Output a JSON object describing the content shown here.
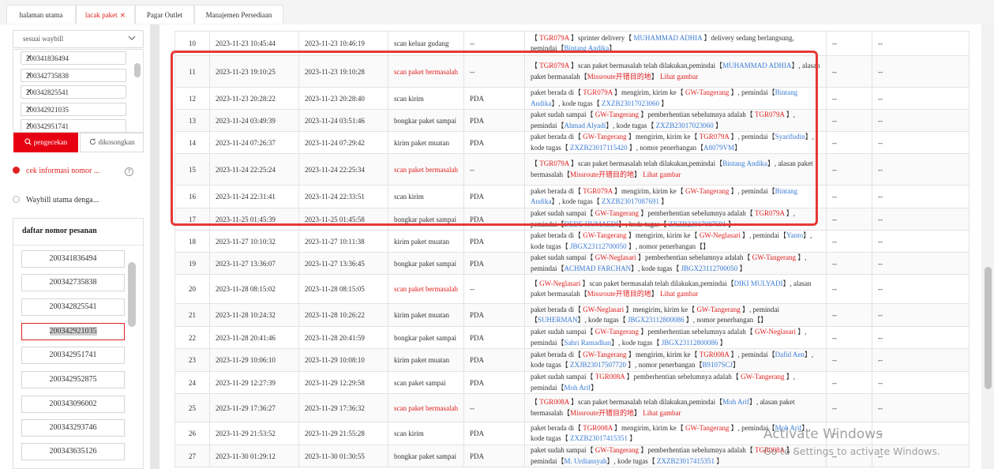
{
  "tabs": [
    {
      "label": "halaman utama",
      "closable": false,
      "active": false
    },
    {
      "label": "lacak paket",
      "closable": true,
      "active": true
    },
    {
      "label": "Pagar Outlet",
      "closable": false,
      "active": false
    },
    {
      "label": "Manajemen Persediaan",
      "closable": false,
      "active": false
    }
  ],
  "sidebar": {
    "waybill_select": "sesuai waybill",
    "waybill_chips": [
      "200341836494",
      "200342735838",
      "200342825541",
      "200342921035",
      "200342951741"
    ],
    "search_button": "pengecekan",
    "clear_button": "dikosongkan",
    "option_check": "cek informasi nomor ...",
    "option_master": "Waybill utama denga...",
    "order_list_title": "daftar nomor pesanan",
    "orders": [
      "200341836494",
      "200342735838",
      "200342825541",
      "200342921035",
      "200342951741",
      "200342952875",
      "200343096002",
      "200343293746",
      "200343635126"
    ],
    "selected_order_index": 3
  },
  "table": {
    "rows": [
      {
        "no": "10",
        "t1": "2023-11-23 10:45:44",
        "t2": "2023-11-23 10:46:19",
        "type": "scan keluar gudang",
        "type_red": false,
        "op": "--",
        "desc": [
          {
            "t": "【 "
          },
          {
            "t": "TGR079A",
            "c": "r"
          },
          {
            "t": " 】sprinter delivery【 "
          },
          {
            "t": "MUHAMMAD ADHIA",
            "c": "b"
          },
          {
            "t": " 】delivery sedang berlangsung, pemindai【"
          },
          {
            "t": "Bintang Andika",
            "c": "b"
          },
          {
            "t": "】"
          }
        ],
        "e1": "--",
        "e2": "--"
      },
      {
        "no": "11",
        "t1": "2023-11-23 19:10:25",
        "t2": "2023-11-23 19:10:28",
        "type": "scan paket bermasalah",
        "type_red": true,
        "op": "--",
        "desc": [
          {
            "t": "【 "
          },
          {
            "t": "TGR079A",
            "c": "r"
          },
          {
            "t": " 】scan paket bermasalah telah dilakukan,pemindai【"
          },
          {
            "t": "MUHAMMAD ADHIA",
            "c": "b"
          },
          {
            "t": "】, alasan paket bermasalah【"
          },
          {
            "t": "Missroute开错目的地",
            "c": "r"
          },
          {
            "t": "】 "
          },
          {
            "t": "Lihat gambar",
            "c": "r"
          }
        ],
        "e1": "--",
        "e2": "--"
      },
      {
        "no": "12",
        "t1": "2023-11-23 20:28:22",
        "t2": "2023-11-23 20:28:40",
        "type": "scan kirim",
        "type_red": false,
        "op": "PDA",
        "desc": [
          {
            "t": "paket berada di【 "
          },
          {
            "t": "TGR079A",
            "c": "r"
          },
          {
            "t": " 】mengirim, kirim ke【 "
          },
          {
            "t": "GW-Tangerang",
            "c": "r"
          },
          {
            "t": " 】, pemindai【"
          },
          {
            "t": "Bintang Andika",
            "c": "b"
          },
          {
            "t": "】, kode tugas【 "
          },
          {
            "t": "ZXZB23017023060",
            "c": "b"
          },
          {
            "t": " 】"
          }
        ],
        "e1": "--",
        "e2": "--"
      },
      {
        "no": "13",
        "t1": "2023-11-24 03:49:39",
        "t2": "2023-11-24 03:51:46",
        "type": "bongkar paket sampai",
        "type_red": false,
        "op": "PDA",
        "desc": [
          {
            "t": "paket sudah sampai【 "
          },
          {
            "t": "GW-Tangerang",
            "c": "r"
          },
          {
            "t": " 】pemberhentian sebelumnya adalah【 "
          },
          {
            "t": "TGR079A",
            "c": "r"
          },
          {
            "t": " 】, pemindai【"
          },
          {
            "t": "Ahmad Alyadi",
            "c": "b"
          },
          {
            "t": "】, kode tugas【 "
          },
          {
            "t": "ZXZB23017023060",
            "c": "b"
          },
          {
            "t": " 】"
          }
        ],
        "e1": "--",
        "e2": "--"
      },
      {
        "no": "14",
        "t1": "2023-11-24 07:26:37",
        "t2": "2023-11-24 07:29:42",
        "type": "kirim paket muatan",
        "type_red": false,
        "op": "PDA",
        "desc": [
          {
            "t": "paket berada di【 "
          },
          {
            "t": "GW-Tangerang",
            "c": "r"
          },
          {
            "t": " 】mengirim, kirim ke【 "
          },
          {
            "t": "TGR079A",
            "c": "r"
          },
          {
            "t": " 】, pemindai【"
          },
          {
            "t": "Syarifudin",
            "c": "b"
          },
          {
            "t": "】, kode tugas【 "
          },
          {
            "t": "ZXZB23017115420",
            "c": "b"
          },
          {
            "t": " 】, nomor penerbangan【"
          },
          {
            "t": "A8079VM",
            "c": "b"
          },
          {
            "t": "】"
          }
        ],
        "e1": "--",
        "e2": "--"
      },
      {
        "no": "15",
        "t1": "2023-11-24 22:25:24",
        "t2": "2023-11-24 22:25:34",
        "type": "scan paket bermasalah",
        "type_red": true,
        "op": "--",
        "desc": [
          {
            "t": "【 "
          },
          {
            "t": "TGR079A",
            "c": "r"
          },
          {
            "t": " 】scan paket bermasalah telah dilakukan,pemindai【"
          },
          {
            "t": "Bintang Andika",
            "c": "b"
          },
          {
            "t": "】, alasan paket bermasalah【"
          },
          {
            "t": "Missroute开错目的地",
            "c": "r"
          },
          {
            "t": "】 "
          },
          {
            "t": "Lihat gambar",
            "c": "r"
          }
        ],
        "e1": "--",
        "e2": "--"
      },
      {
        "no": "16",
        "t1": "2023-11-24 22:31:41",
        "t2": "2023-11-24 22:33:51",
        "type": "scan kirim",
        "type_red": false,
        "op": "PDA",
        "desc": [
          {
            "t": "paket berada di【 "
          },
          {
            "t": "TGR079A",
            "c": "r"
          },
          {
            "t": " 】mengirim, kirim ke【 "
          },
          {
            "t": "GW-Tangerang",
            "c": "r"
          },
          {
            "t": " 】, pemindai【"
          },
          {
            "t": "Bintang Andika",
            "c": "b"
          },
          {
            "t": "】, kode tugas【 "
          },
          {
            "t": "ZXZB23017087691",
            "c": "b"
          },
          {
            "t": " 】"
          }
        ],
        "e1": "--",
        "e2": "--"
      },
      {
        "no": "17",
        "t1": "2023-11-25 01:45:39",
        "t2": "2023-11-25 01:45:58",
        "type": "bongkar paket sampai",
        "type_red": false,
        "op": "PDA",
        "desc": [
          {
            "t": "paket sudah sampai【 "
          },
          {
            "t": "GW-Tangerang",
            "c": "r"
          },
          {
            "t": " 】pemberhentian sebelumnya adalah【 "
          },
          {
            "t": "TGR079A",
            "c": "r"
          },
          {
            "t": " 】, pemindai【"
          },
          {
            "t": "DEDE HUMAEDI",
            "c": "b"
          },
          {
            "t": "】, kode tugas【 "
          },
          {
            "t": "ZXZB23017087691",
            "c": "b"
          },
          {
            "t": " 】"
          }
        ],
        "e1": "--",
        "e2": "--"
      },
      {
        "no": "18",
        "t1": "2023-11-27 10:10:32",
        "t2": "2023-11-27 10:11:38",
        "type": "kirim paket muatan",
        "type_red": false,
        "op": "PDA",
        "desc": [
          {
            "t": "paket berada di【 "
          },
          {
            "t": "GW-Tangerang",
            "c": "r"
          },
          {
            "t": " 】mengirim, kirim ke【 "
          },
          {
            "t": "GW-Neglasari",
            "c": "r"
          },
          {
            "t": " 】, pemindai【"
          },
          {
            "t": "Yanto",
            "c": "b"
          },
          {
            "t": "】, kode tugas【 "
          },
          {
            "t": "JBGX23112700050",
            "c": "b"
          },
          {
            "t": " 】, nomor penerbangan【】"
          }
        ],
        "e1": "--",
        "e2": "--"
      },
      {
        "no": "19",
        "t1": "2023-11-27 13:36:07",
        "t2": "2023-11-27 13:36:45",
        "type": "bongkar paket sampai",
        "type_red": false,
        "op": "PDA",
        "desc": [
          {
            "t": "paket sudah sampai【 "
          },
          {
            "t": "GW-Neglasari",
            "c": "r"
          },
          {
            "t": " 】pemberhentian sebelumnya adalah【 "
          },
          {
            "t": "GW-Tangerang",
            "c": "r"
          },
          {
            "t": " 】, pemindai【"
          },
          {
            "t": "ACHMAD FARCHAN",
            "c": "b"
          },
          {
            "t": "】, kode tugas【 "
          },
          {
            "t": "JBGX23112700050",
            "c": "b"
          },
          {
            "t": " 】"
          }
        ],
        "e1": "--",
        "e2": "--"
      },
      {
        "no": "20",
        "t1": "2023-11-28 08:15:02",
        "t2": "2023-11-28 08:15:05",
        "type": "scan paket bermasalah",
        "type_red": true,
        "op": "--",
        "desc": [
          {
            "t": "【 "
          },
          {
            "t": "GW-Neglasari",
            "c": "r"
          },
          {
            "t": " 】scan paket bermasalah telah dilakukan,pemindai【"
          },
          {
            "t": "DIKI MULYADI",
            "c": "b"
          },
          {
            "t": "】, alasan paket bermasalah【"
          },
          {
            "t": "Missroute开错目的地",
            "c": "r"
          },
          {
            "t": "】 "
          },
          {
            "t": "Lihat gambar",
            "c": "r"
          }
        ],
        "e1": "--",
        "e2": "--"
      },
      {
        "no": "21",
        "t1": "2023-11-28 10:24:32",
        "t2": "2023-11-28 10:26:22",
        "type": "kirim paket muatan",
        "type_red": false,
        "op": "PDA",
        "desc": [
          {
            "t": "paket berada di【 "
          },
          {
            "t": "GW-Neglasari",
            "c": "r"
          },
          {
            "t": " 】mengirim, kirim ke【 "
          },
          {
            "t": "GW-Tangerang",
            "c": "r"
          },
          {
            "t": " 】, pemindai【"
          },
          {
            "t": "SUHERMAN",
            "c": "b"
          },
          {
            "t": "】, kode tugas【 "
          },
          {
            "t": "JBGX23112800086",
            "c": "b"
          },
          {
            "t": " 】, nomor penerbangan【】"
          }
        ],
        "e1": "--",
        "e2": "--"
      },
      {
        "no": "22",
        "t1": "2023-11-28 20:41:46",
        "t2": "2023-11-28 20:41:59",
        "type": "bongkar paket sampai",
        "type_red": false,
        "op": "PDA",
        "desc": [
          {
            "t": "paket sudah sampai【 "
          },
          {
            "t": "GW-Tangerang",
            "c": "r"
          },
          {
            "t": " 】pemberhentian sebelumnya adalah【 "
          },
          {
            "t": "GW-Neglasari",
            "c": "r"
          },
          {
            "t": " 】, pemindai【"
          },
          {
            "t": "Sahri Ramadhan",
            "c": "b"
          },
          {
            "t": "】, kode tugas【 "
          },
          {
            "t": "JBGX23112800086",
            "c": "b"
          },
          {
            "t": " 】"
          }
        ],
        "e1": "--",
        "e2": "--"
      },
      {
        "no": "23",
        "t1": "2023-11-29 10:06:10",
        "t2": "2023-11-29 10:08:10",
        "type": "kirim paket muatan",
        "type_red": false,
        "op": "PDA",
        "desc": [
          {
            "t": "paket berada di【 "
          },
          {
            "t": "GW-Tangerang",
            "c": "r"
          },
          {
            "t": " 】mengirim, kirim ke【 "
          },
          {
            "t": "TGR008A",
            "c": "r"
          },
          {
            "t": " 】, pemindai【"
          },
          {
            "t": "Dafid Aen",
            "c": "b"
          },
          {
            "t": "】, kode tugas【 "
          },
          {
            "t": "ZXJB23017507720",
            "c": "b"
          },
          {
            "t": " 】, nomor penerbangan【"
          },
          {
            "t": "B9107SCJ",
            "c": "b"
          },
          {
            "t": "】"
          }
        ],
        "e1": "--",
        "e2": "--"
      },
      {
        "no": "24",
        "t1": "2023-11-29 12:27:39",
        "t2": "2023-11-29 12:29:58",
        "type": "scan paket sampai",
        "type_red": false,
        "op": "PDA",
        "desc": [
          {
            "t": "paket sudah sampai【 "
          },
          {
            "t": "TGR008A",
            "c": "r"
          },
          {
            "t": " 】pemberhentian sebelumnya adalah【 "
          },
          {
            "t": "GW-Tangerang",
            "c": "r"
          },
          {
            "t": " 】, pemindai【"
          },
          {
            "t": "Moh Arif",
            "c": "b"
          },
          {
            "t": "】"
          }
        ],
        "e1": "--",
        "e2": "--"
      },
      {
        "no": "25",
        "t1": "2023-11-29 17:36:27",
        "t2": "2023-11-29 17:36:32",
        "type": "scan paket bermasalah",
        "type_red": true,
        "op": "--",
        "desc": [
          {
            "t": "【 "
          },
          {
            "t": "TGR008A",
            "c": "r"
          },
          {
            "t": " 】scan paket bermasalah telah dilakukan,pemindai【"
          },
          {
            "t": "Moh Arif",
            "c": "b"
          },
          {
            "t": "】, alasan paket bermasalah【"
          },
          {
            "t": "Missroute开错目的地",
            "c": "r"
          },
          {
            "t": "】 "
          },
          {
            "t": "Lihat gambar",
            "c": "r"
          }
        ],
        "e1": "--",
        "e2": "--"
      },
      {
        "no": "26",
        "t1": "2023-11-29 21:53:52",
        "t2": "2023-11-29 21:55:28",
        "type": "scan kirim",
        "type_red": false,
        "op": "PDA",
        "desc": [
          {
            "t": "paket berada di【 "
          },
          {
            "t": "TGR008A",
            "c": "r"
          },
          {
            "t": " 】mengirim, kirim ke【 "
          },
          {
            "t": "GW-Tangerang",
            "c": "r"
          },
          {
            "t": " 】, pemindai【"
          },
          {
            "t": "Moh Arif",
            "c": "b"
          },
          {
            "t": "】, kode tugas【 "
          },
          {
            "t": "ZXZB23017415351",
            "c": "b"
          },
          {
            "t": " 】"
          }
        ],
        "e1": "--",
        "e2": "--"
      },
      {
        "no": "27",
        "t1": "2023-11-30 01:29:12",
        "t2": "2023-11-30 01:30:55",
        "type": "bongkar paket sampai",
        "type_red": false,
        "op": "PDA",
        "desc": [
          {
            "t": "paket sudah sampai【 "
          },
          {
            "t": "GW-Tangerang",
            "c": "r"
          },
          {
            "t": " 】pemberhentian sebelumnya adalah【 "
          },
          {
            "t": "TGR008A",
            "c": "r"
          },
          {
            "t": " 】, pemindai【"
          },
          {
            "t": "M. Urdiansyah",
            "c": "b"
          },
          {
            "t": "】, kode tugas【 "
          },
          {
            "t": "ZXZB23017415351",
            "c": "b"
          },
          {
            "t": " 】"
          }
        ],
        "e1": "--",
        "e2": "--"
      }
    ]
  },
  "watermark": {
    "line1": "Activate Windows",
    "line2": "Go to Settings to activate Windows."
  },
  "colors": {
    "accent": "#e60012",
    "highlight_box": "#e53935",
    "link_blue": "#3a7bd5",
    "code_red": "#e02020"
  }
}
